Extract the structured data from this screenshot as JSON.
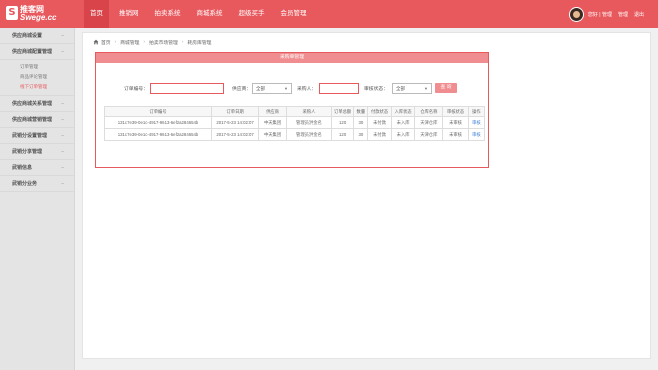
{
  "header": {
    "logo_badge": "S",
    "logo_top": "推客网",
    "logo_bottom": "Swege.cc",
    "nav": [
      "首页",
      "推销网",
      "拍卖系统",
      "商城系统",
      "超级买手",
      "会员管理"
    ],
    "active_nav": 0,
    "user_links": [
      "您好 | 管理",
      "管理",
      "退出"
    ]
  },
  "sidebar": [
    {
      "label": "供应商城设置",
      "expanded": false,
      "items": []
    },
    {
      "label": "供应商城配置管理",
      "expanded": true,
      "items": [
        {
          "label": "订单管理",
          "active": false
        },
        {
          "label": "商品评论管理",
          "active": false
        },
        {
          "label": "线下订单管理",
          "active": true
        }
      ]
    },
    {
      "label": "供应商城关系管理",
      "expanded": false,
      "items": []
    },
    {
      "label": "供应商城营销管理",
      "expanded": false,
      "items": []
    },
    {
      "label": "武销分设置管理",
      "expanded": false,
      "items": []
    },
    {
      "label": "武销分享管理",
      "expanded": false,
      "items": []
    },
    {
      "label": "武销信息",
      "expanded": false,
      "items": []
    },
    {
      "label": "武销分业务",
      "expanded": false,
      "items": []
    }
  ],
  "breadcrumb": {
    "items": [
      "首页",
      "商城管理",
      "拍卖市场管理",
      "耗房库管理"
    ]
  },
  "panel": {
    "title": "采购单管理",
    "search": {
      "order_label": "订单编号：",
      "order_value": "",
      "supplier_label": "供应商：",
      "supplier_value": "全部",
      "buyer_label": "采购人：",
      "buyer_value": "",
      "status_label": "审核状态：",
      "status_value": "全部",
      "search_button": "查 询"
    },
    "table": {
      "columns": [
        "订单编号",
        "订单日期",
        "供应商",
        "采购人",
        "订单总额",
        "数量",
        "付款状态",
        "入库状态",
        "仓库名称",
        "审核状态",
        "操作"
      ],
      "rows": [
        [
          "131c7e39-0e1c-4917-9613-6ef2a284654b",
          "2017-5-23 14:02:07",
          "中天集团",
          "管理员洪金名",
          "120",
          "30",
          "未付款",
          "未入库",
          "天津仓库",
          "未审核",
          "审核"
        ],
        [
          "131c7e39-0e1c-4917-9613-6ef2a284654b",
          "2017-5-23 14:02:07",
          "中天集团",
          "管理员洪金名",
          "120",
          "30",
          "未付款",
          "未入库",
          "天津仓库",
          "未审核",
          "审核"
        ]
      ]
    }
  }
}
